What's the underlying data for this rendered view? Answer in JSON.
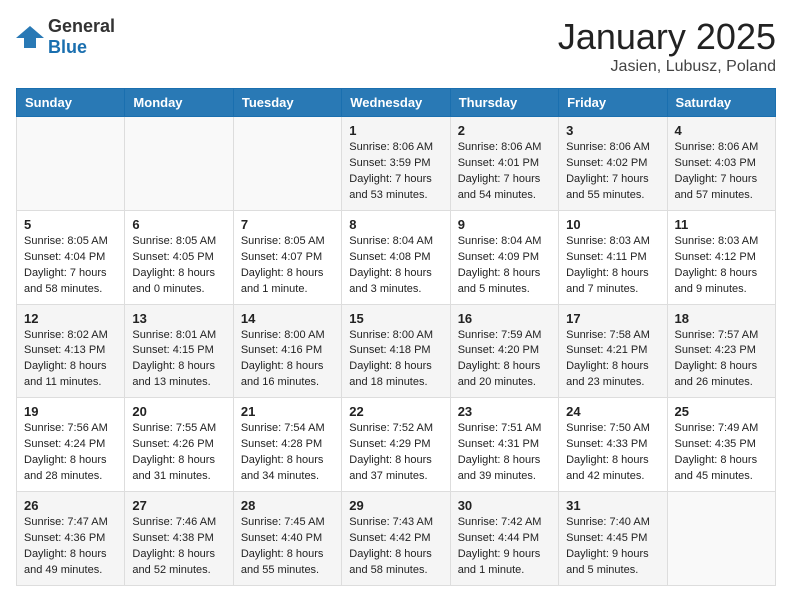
{
  "logo": {
    "general": "General",
    "blue": "Blue"
  },
  "title": {
    "month": "January 2025",
    "location": "Jasien, Lubusz, Poland"
  },
  "headers": [
    "Sunday",
    "Monday",
    "Tuesday",
    "Wednesday",
    "Thursday",
    "Friday",
    "Saturday"
  ],
  "weeks": [
    [
      {
        "day": "",
        "info": ""
      },
      {
        "day": "",
        "info": ""
      },
      {
        "day": "",
        "info": ""
      },
      {
        "day": "1",
        "info": "Sunrise: 8:06 AM\nSunset: 3:59 PM\nDaylight: 7 hours and 53 minutes."
      },
      {
        "day": "2",
        "info": "Sunrise: 8:06 AM\nSunset: 4:01 PM\nDaylight: 7 hours and 54 minutes."
      },
      {
        "day": "3",
        "info": "Sunrise: 8:06 AM\nSunset: 4:02 PM\nDaylight: 7 hours and 55 minutes."
      },
      {
        "day": "4",
        "info": "Sunrise: 8:06 AM\nSunset: 4:03 PM\nDaylight: 7 hours and 57 minutes."
      }
    ],
    [
      {
        "day": "5",
        "info": "Sunrise: 8:05 AM\nSunset: 4:04 PM\nDaylight: 7 hours and 58 minutes."
      },
      {
        "day": "6",
        "info": "Sunrise: 8:05 AM\nSunset: 4:05 PM\nDaylight: 8 hours and 0 minutes."
      },
      {
        "day": "7",
        "info": "Sunrise: 8:05 AM\nSunset: 4:07 PM\nDaylight: 8 hours and 1 minute."
      },
      {
        "day": "8",
        "info": "Sunrise: 8:04 AM\nSunset: 4:08 PM\nDaylight: 8 hours and 3 minutes."
      },
      {
        "day": "9",
        "info": "Sunrise: 8:04 AM\nSunset: 4:09 PM\nDaylight: 8 hours and 5 minutes."
      },
      {
        "day": "10",
        "info": "Sunrise: 8:03 AM\nSunset: 4:11 PM\nDaylight: 8 hours and 7 minutes."
      },
      {
        "day": "11",
        "info": "Sunrise: 8:03 AM\nSunset: 4:12 PM\nDaylight: 8 hours and 9 minutes."
      }
    ],
    [
      {
        "day": "12",
        "info": "Sunrise: 8:02 AM\nSunset: 4:13 PM\nDaylight: 8 hours and 11 minutes."
      },
      {
        "day": "13",
        "info": "Sunrise: 8:01 AM\nSunset: 4:15 PM\nDaylight: 8 hours and 13 minutes."
      },
      {
        "day": "14",
        "info": "Sunrise: 8:00 AM\nSunset: 4:16 PM\nDaylight: 8 hours and 16 minutes."
      },
      {
        "day": "15",
        "info": "Sunrise: 8:00 AM\nSunset: 4:18 PM\nDaylight: 8 hours and 18 minutes."
      },
      {
        "day": "16",
        "info": "Sunrise: 7:59 AM\nSunset: 4:20 PM\nDaylight: 8 hours and 20 minutes."
      },
      {
        "day": "17",
        "info": "Sunrise: 7:58 AM\nSunset: 4:21 PM\nDaylight: 8 hours and 23 minutes."
      },
      {
        "day": "18",
        "info": "Sunrise: 7:57 AM\nSunset: 4:23 PM\nDaylight: 8 hours and 26 minutes."
      }
    ],
    [
      {
        "day": "19",
        "info": "Sunrise: 7:56 AM\nSunset: 4:24 PM\nDaylight: 8 hours and 28 minutes."
      },
      {
        "day": "20",
        "info": "Sunrise: 7:55 AM\nSunset: 4:26 PM\nDaylight: 8 hours and 31 minutes."
      },
      {
        "day": "21",
        "info": "Sunrise: 7:54 AM\nSunset: 4:28 PM\nDaylight: 8 hours and 34 minutes."
      },
      {
        "day": "22",
        "info": "Sunrise: 7:52 AM\nSunset: 4:29 PM\nDaylight: 8 hours and 37 minutes."
      },
      {
        "day": "23",
        "info": "Sunrise: 7:51 AM\nSunset: 4:31 PM\nDaylight: 8 hours and 39 minutes."
      },
      {
        "day": "24",
        "info": "Sunrise: 7:50 AM\nSunset: 4:33 PM\nDaylight: 8 hours and 42 minutes."
      },
      {
        "day": "25",
        "info": "Sunrise: 7:49 AM\nSunset: 4:35 PM\nDaylight: 8 hours and 45 minutes."
      }
    ],
    [
      {
        "day": "26",
        "info": "Sunrise: 7:47 AM\nSunset: 4:36 PM\nDaylight: 8 hours and 49 minutes."
      },
      {
        "day": "27",
        "info": "Sunrise: 7:46 AM\nSunset: 4:38 PM\nDaylight: 8 hours and 52 minutes."
      },
      {
        "day": "28",
        "info": "Sunrise: 7:45 AM\nSunset: 4:40 PM\nDaylight: 8 hours and 55 minutes."
      },
      {
        "day": "29",
        "info": "Sunrise: 7:43 AM\nSunset: 4:42 PM\nDaylight: 8 hours and 58 minutes."
      },
      {
        "day": "30",
        "info": "Sunrise: 7:42 AM\nSunset: 4:44 PM\nDaylight: 9 hours and 1 minute."
      },
      {
        "day": "31",
        "info": "Sunrise: 7:40 AM\nSunset: 4:45 PM\nDaylight: 9 hours and 5 minutes."
      },
      {
        "day": "",
        "info": ""
      }
    ]
  ]
}
